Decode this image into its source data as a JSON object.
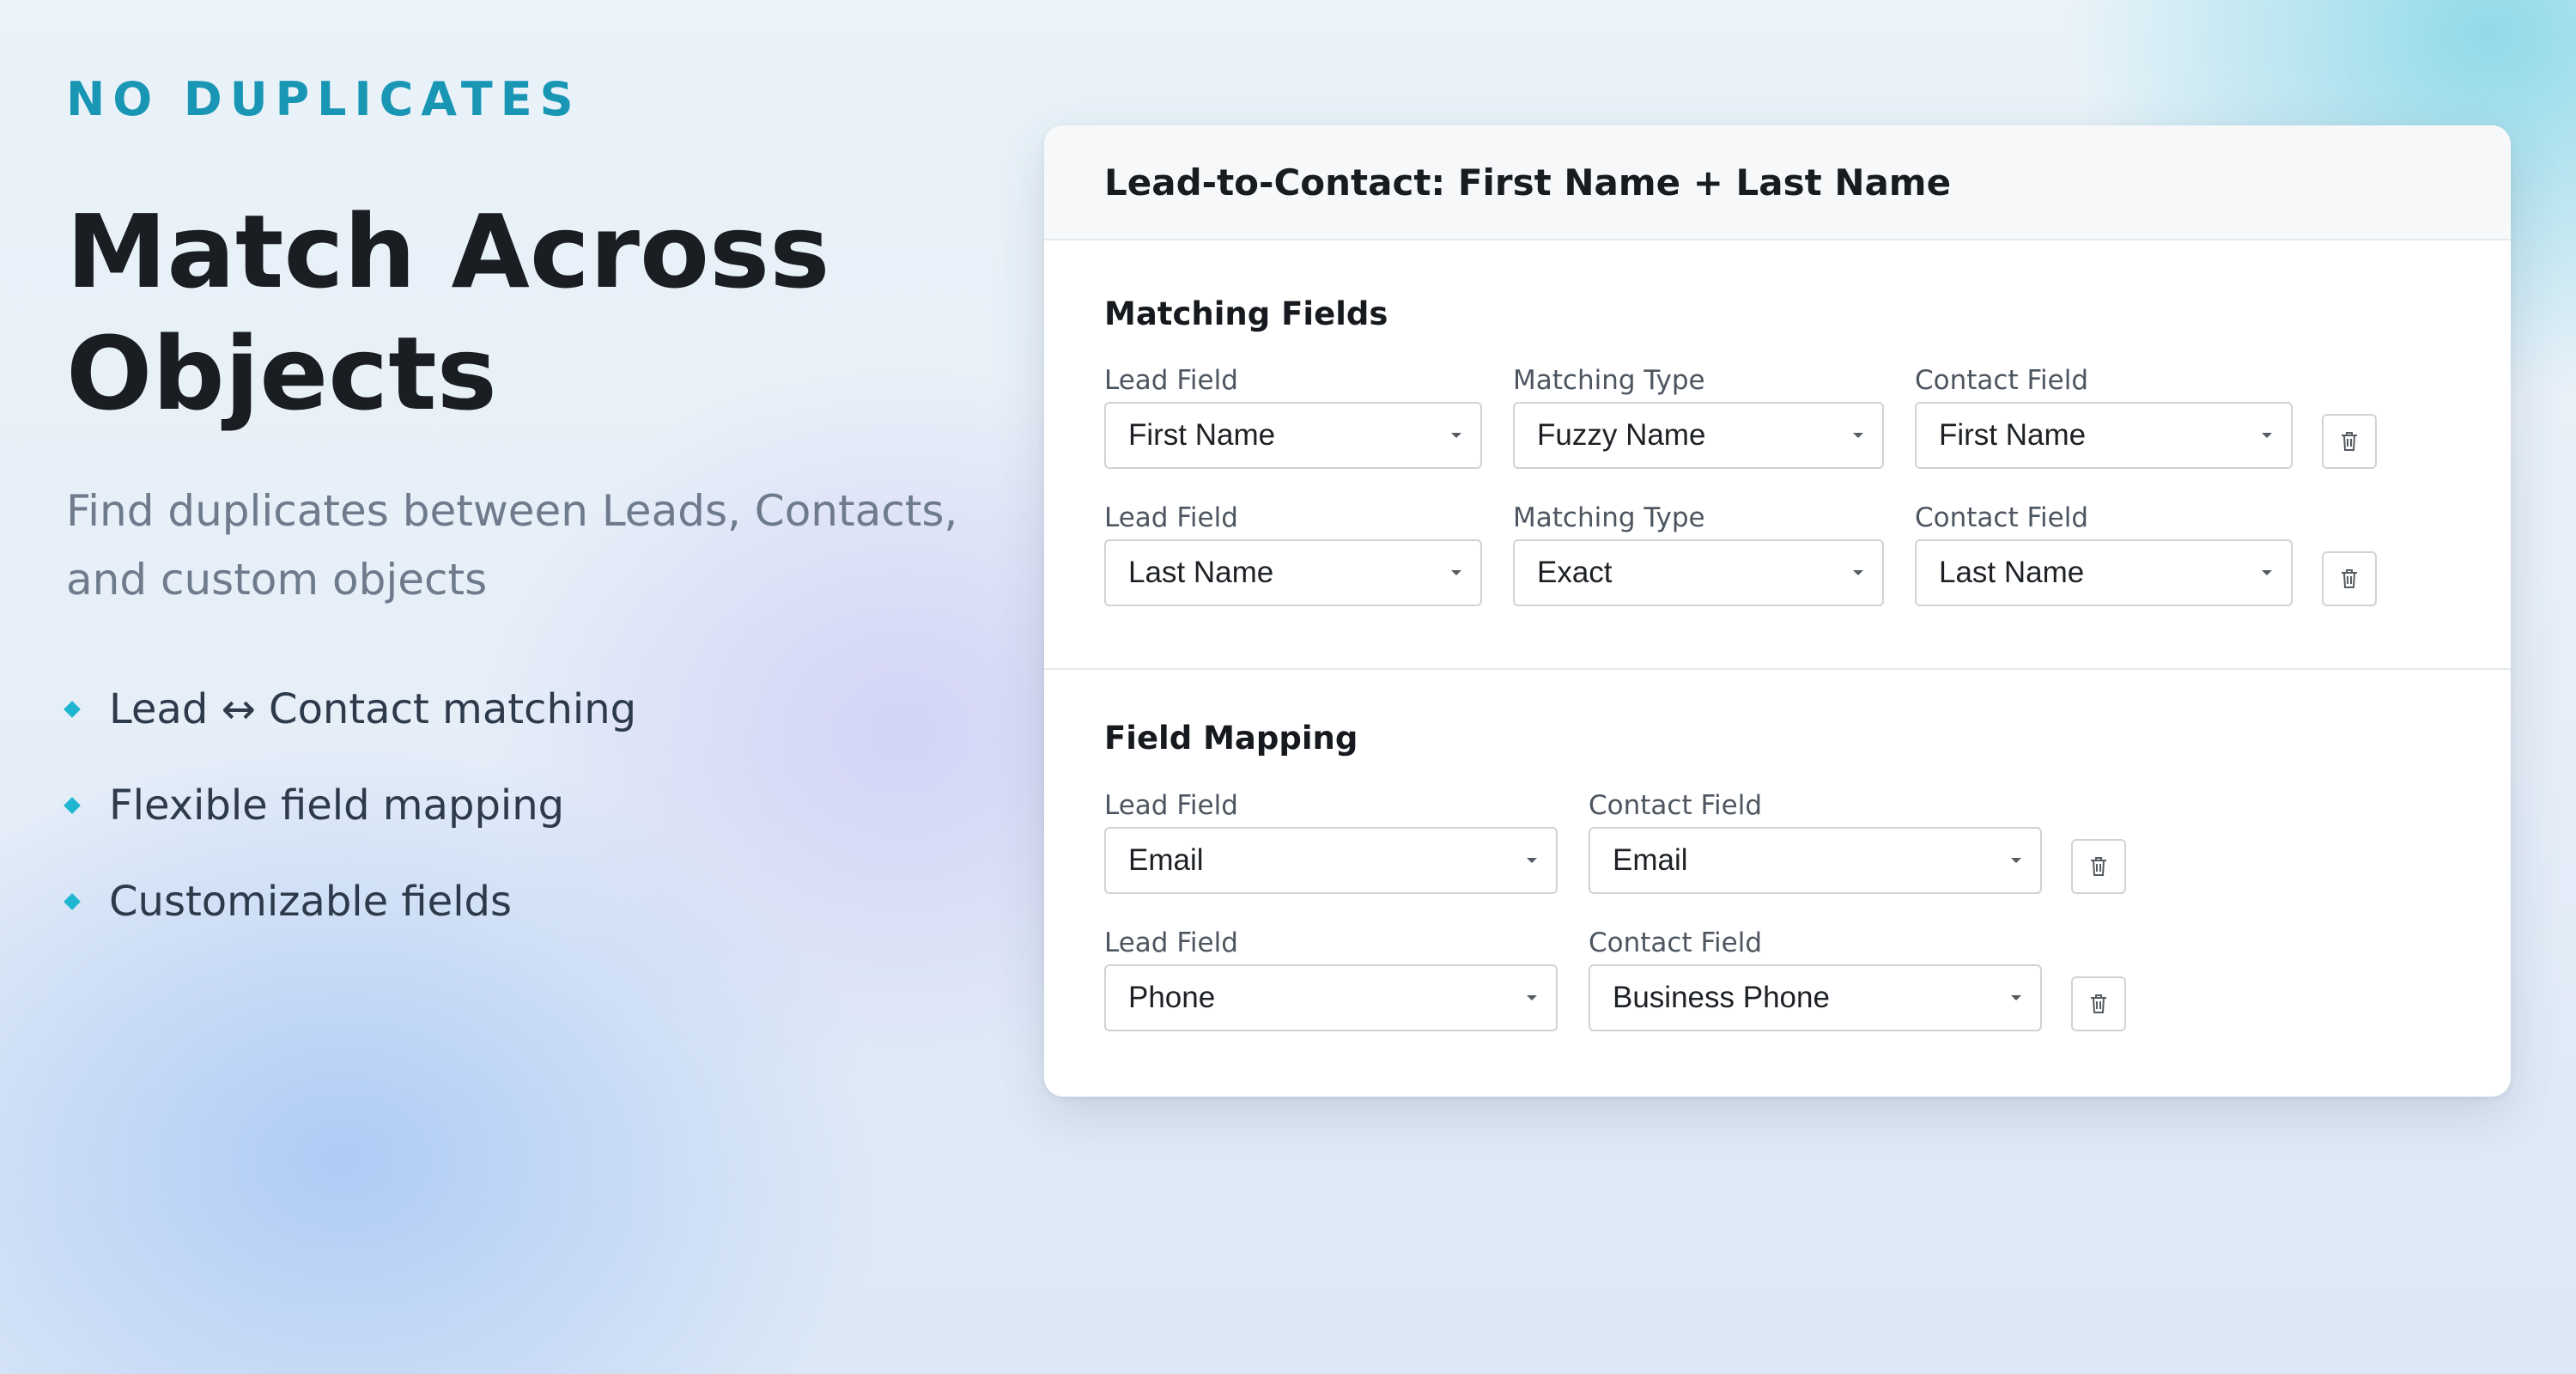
{
  "hero": {
    "eyebrow": "NO DUPLICATES",
    "headline": "Match Across Objects",
    "subtitle": "Find duplicates between Leads, Contacts, and custom objects",
    "features": [
      "Lead ↔ Contact matching",
      "Flexible field mapping",
      "Customizable fields"
    ]
  },
  "card": {
    "title": "Lead-to-Contact: First Name + Last Name",
    "matching": {
      "title": "Matching Fields",
      "rows": [
        {
          "lead_label": "Lead Field",
          "lead_value": "First Name",
          "type_label": "Matching Type",
          "type_value": "Fuzzy Name",
          "contact_label": "Contact Field",
          "contact_value": "First Name"
        },
        {
          "lead_label": "Lead Field",
          "lead_value": "Last Name",
          "type_label": "Matching Type",
          "type_value": "Exact",
          "contact_label": "Contact Field",
          "contact_value": "Last Name"
        }
      ]
    },
    "mapping": {
      "title": "Field Mapping",
      "rows": [
        {
          "lead_label": "Lead Field",
          "lead_value": "Email",
          "contact_label": "Contact Field",
          "contact_value": "Email"
        },
        {
          "lead_label": "Lead Field",
          "lead_value": "Phone",
          "contact_label": "Contact Field",
          "contact_value": "Business Phone"
        }
      ]
    }
  },
  "colors": {
    "accent": "#1896b4",
    "bullet": "#1fb6d2"
  }
}
